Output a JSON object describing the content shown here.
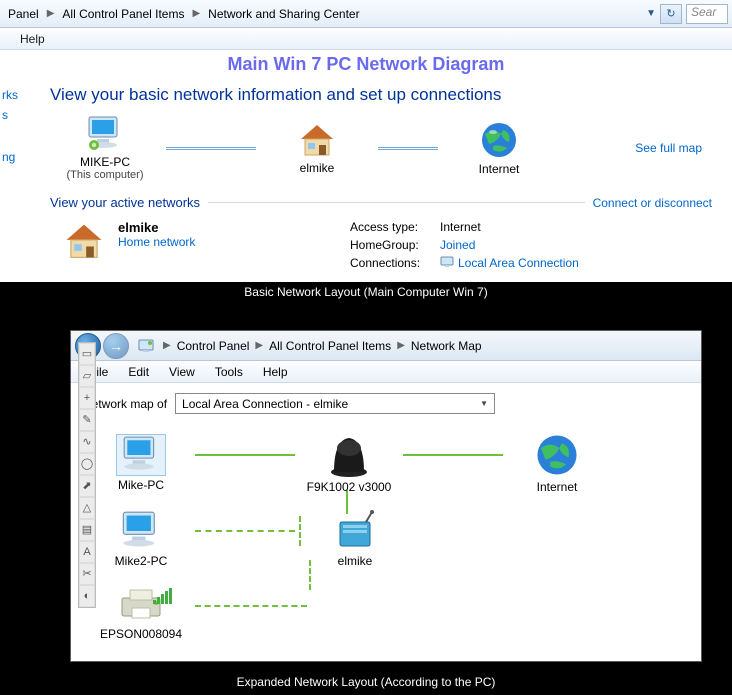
{
  "top": {
    "breadcrumbs": [
      "Panel",
      "All Control Panel Items",
      "Network and Sharing Center"
    ],
    "search_placeholder": "Sear",
    "menu": {
      "help": "Help"
    },
    "title": "Main Win 7 PC Network Diagram",
    "left_links": [
      "rks",
      "s",
      "ng"
    ],
    "heading": "View your basic network information and set up connections",
    "see_full_map": "See full map",
    "nodes": {
      "pc": {
        "label": "MIKE-PC",
        "sub": "(This computer)"
      },
      "house": {
        "label": "elmike"
      },
      "globe": {
        "label": "Internet"
      }
    },
    "active_header": "View your active networks",
    "connect_link": "Connect or disconnect",
    "active_net": {
      "name": "elmike",
      "type": "Home network"
    },
    "kv": {
      "access_label": "Access type:",
      "access_value": "Internet",
      "hg_label": "HomeGroup:",
      "hg_value": "Joined",
      "conn_label": "Connections:",
      "conn_value": "Local Area Connection"
    },
    "caption": "Basic Network Layout (Main Computer Win 7)"
  },
  "bottom": {
    "breadcrumbs": [
      "Control Panel",
      "All Control Panel Items",
      "Network Map"
    ],
    "menus": [
      "File",
      "Edit",
      "View",
      "Tools",
      "Help"
    ],
    "map_of_label": "Network map of",
    "map_of_value": "Local Area Connection - elmike",
    "nodes": {
      "pc1": "Mike-PC",
      "router": "F9K1002 v3000",
      "globe": "Internet",
      "pc2": "Mike2-PC",
      "dev": "elmike",
      "printer": "EPSON008094"
    },
    "caption": "Expanded Network Layout (According to the PC)"
  }
}
